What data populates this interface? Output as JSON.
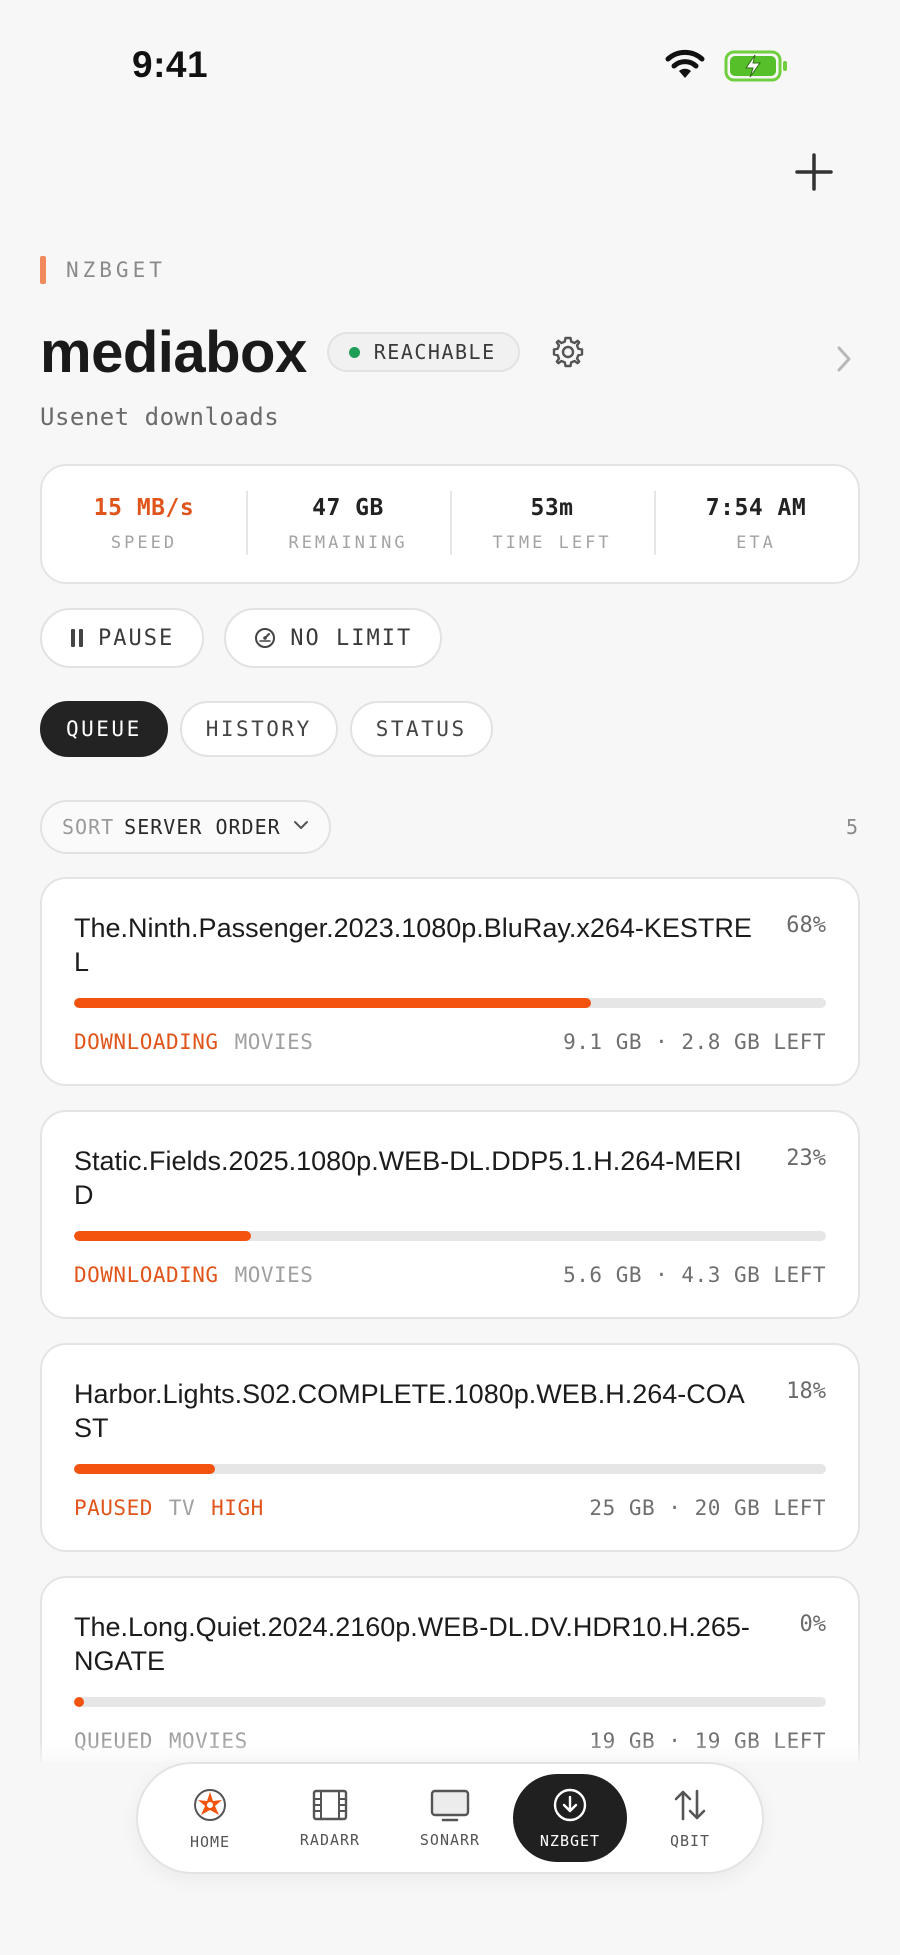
{
  "status_bar": {
    "time": "9:41"
  },
  "header": {
    "eyebrow": "NZBGET",
    "title": "mediabox",
    "badge": "REACHABLE",
    "subtitle": "Usenet downloads"
  },
  "stats": [
    {
      "value": "15 MB/s",
      "label": "SPEED"
    },
    {
      "value": "47 GB",
      "label": "REMAINING"
    },
    {
      "value": "53m",
      "label": "TIME LEFT"
    },
    {
      "value": "7:54 AM",
      "label": "ETA"
    }
  ],
  "actions": {
    "pause_label": "PAUSE",
    "limit_label": "NO LIMIT"
  },
  "tabs": [
    {
      "label": "QUEUE",
      "active": true
    },
    {
      "label": "HISTORY",
      "active": false
    },
    {
      "label": "STATUS",
      "active": false
    }
  ],
  "sort": {
    "prefix": "SORT",
    "value": "SERVER ORDER",
    "count": "5"
  },
  "queue": [
    {
      "name": "The.Ninth.Passenger.2023.1080p.BluRay.x264-KESTREL",
      "percent": "68%",
      "progress": 0.687,
      "status": "DOWNLOADING",
      "category": "MOVIES",
      "priority": "",
      "size": "9.1 GB · 2.8 GB LEFT"
    },
    {
      "name": "Static.Fields.2025.1080p.WEB-DL.DDP5.1.H.264-MERID",
      "percent": "23%",
      "progress": 0.236,
      "status": "DOWNLOADING",
      "category": "MOVIES",
      "priority": "",
      "size": "5.6 GB · 4.3 GB LEFT"
    },
    {
      "name": "Harbor.Lights.S02.COMPLETE.1080p.WEB.H.264-COAST",
      "percent": "18%",
      "progress": 0.188,
      "status": "PAUSED",
      "category": "TV",
      "priority": "HIGH",
      "size": "25 GB · 20 GB LEFT"
    },
    {
      "name": "The.Long.Quiet.2024.2160p.WEB-DL.DV.HDR10.H.265-NGATE",
      "percent": "0%",
      "progress": 0.0,
      "status": "QUEUED",
      "category": "MOVIES",
      "priority": "",
      "size": "19 GB · 19 GB LEFT"
    }
  ],
  "tabbar": [
    {
      "label": "HOME",
      "icon": "home-burst-icon",
      "active": false
    },
    {
      "label": "RADARR",
      "icon": "film-icon",
      "active": false
    },
    {
      "label": "SONARR",
      "icon": "tv-icon",
      "active": false
    },
    {
      "label": "NZBGET",
      "icon": "download-icon",
      "active": true
    },
    {
      "label": "QBIT",
      "icon": "transfer-arrows-icon",
      "active": false
    }
  ],
  "colors": {
    "accent": "#f2540f",
    "reachable": "#1e9e57",
    "dark": "#202020"
  }
}
